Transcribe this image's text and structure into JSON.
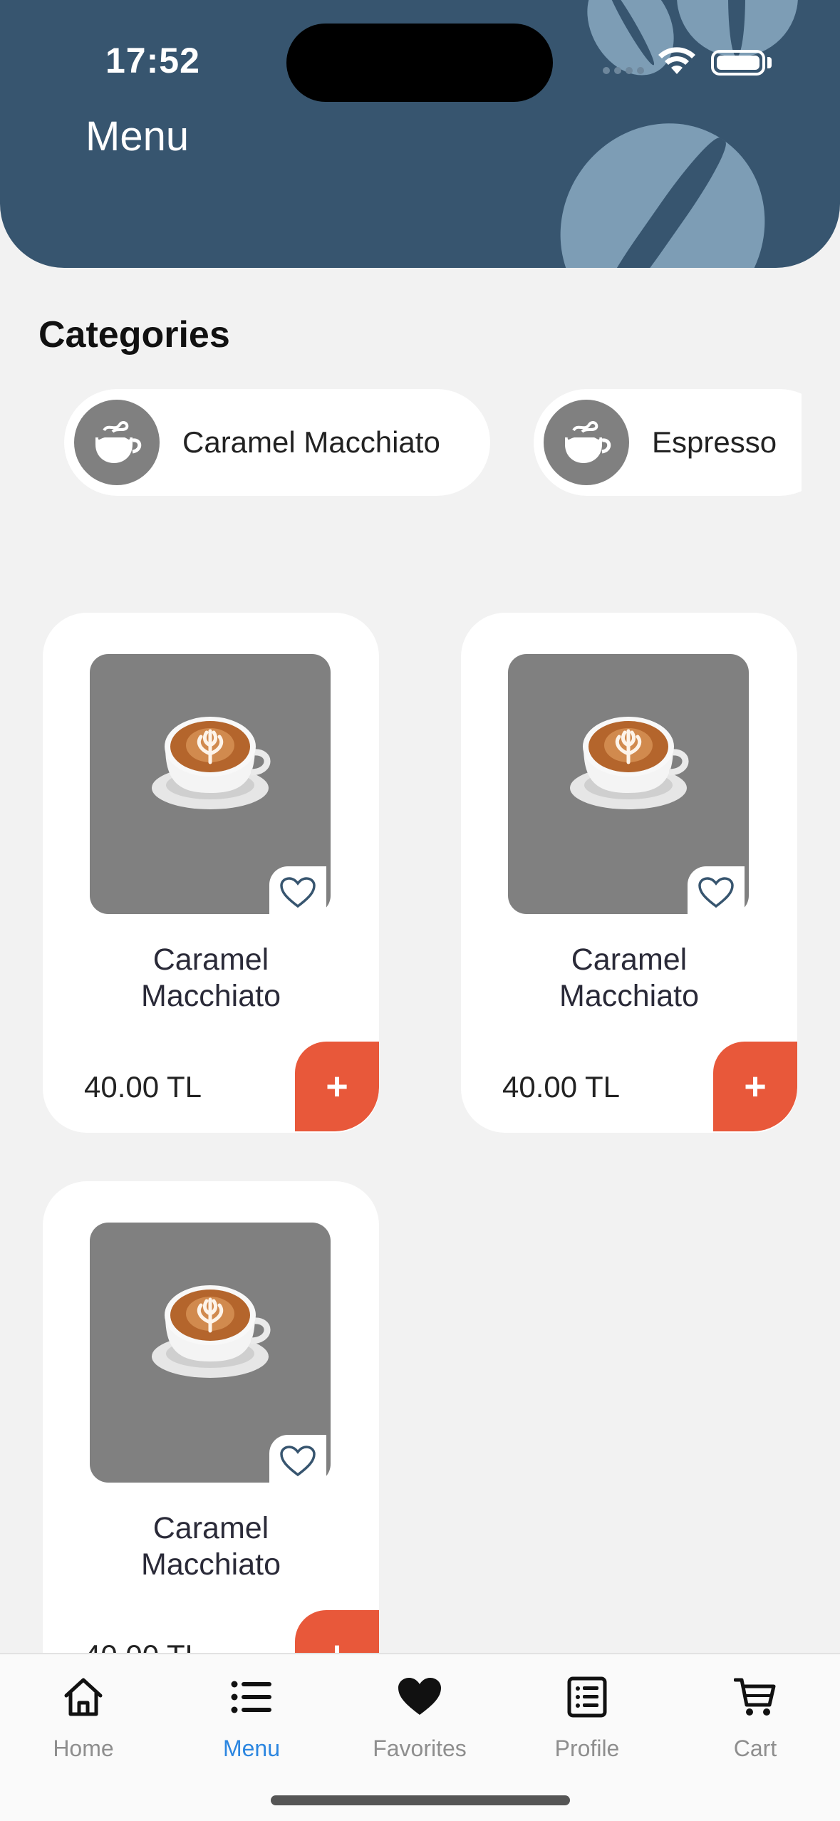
{
  "status_bar": {
    "time": "17:52"
  },
  "header": {
    "title": "Menu"
  },
  "categories": {
    "title": "Categories",
    "items": [
      {
        "label": "Caramel Macchiato",
        "icon": "coffee-cup-icon"
      },
      {
        "label": "Espresso",
        "icon": "coffee-cup-icon"
      }
    ]
  },
  "products": [
    {
      "name": "Caramel Macchiato",
      "price": "40.00 TL",
      "add_label": "+"
    },
    {
      "name": "Caramel Macchiato",
      "price": "40.00 TL",
      "add_label": "+"
    },
    {
      "name": "Caramel Macchiato",
      "price": "40.00 TL",
      "add_label": "+"
    }
  ],
  "tabbar": {
    "items": [
      {
        "label": "Home",
        "icon": "home-icon"
      },
      {
        "label": "Menu",
        "icon": "list-icon",
        "active": true
      },
      {
        "label": "Favorites",
        "icon": "heart-icon"
      },
      {
        "label": "Profile",
        "icon": "profile-icon"
      },
      {
        "label": "Cart",
        "icon": "cart-icon"
      }
    ]
  },
  "colors": {
    "header": "#37556f",
    "accent": "#e8583a",
    "active_tab": "#2c86e0",
    "background": "#f2f2f2"
  }
}
